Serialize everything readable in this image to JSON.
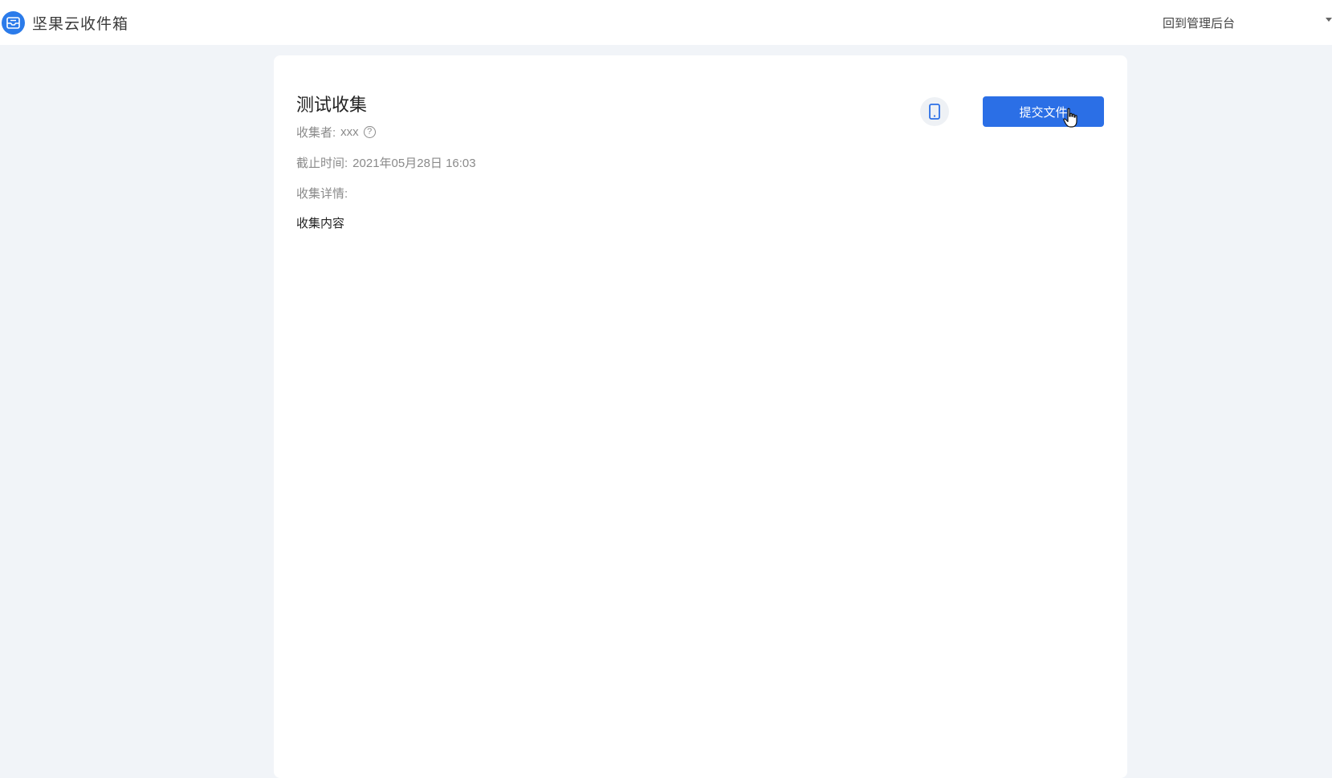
{
  "header": {
    "app_title": "坚果云收件箱",
    "back_link": "回到管理后台",
    "logo_icon": "inbox-icon"
  },
  "collection": {
    "title": "测试收集",
    "collector_label": "收集者:",
    "collector_value": "xxx",
    "help_icon_glyph": "?",
    "deadline_label": "截止时间:",
    "deadline_value": "2021年05月28日 16:03",
    "details_label": "收集详情:",
    "content": "收集内容"
  },
  "actions": {
    "mobile_icon": "mobile-phone-icon",
    "submit_label": "提交文件"
  },
  "colors": {
    "accent": "#2b6fe6",
    "page_bg": "#f1f4f8",
    "card_bg": "#ffffff"
  }
}
